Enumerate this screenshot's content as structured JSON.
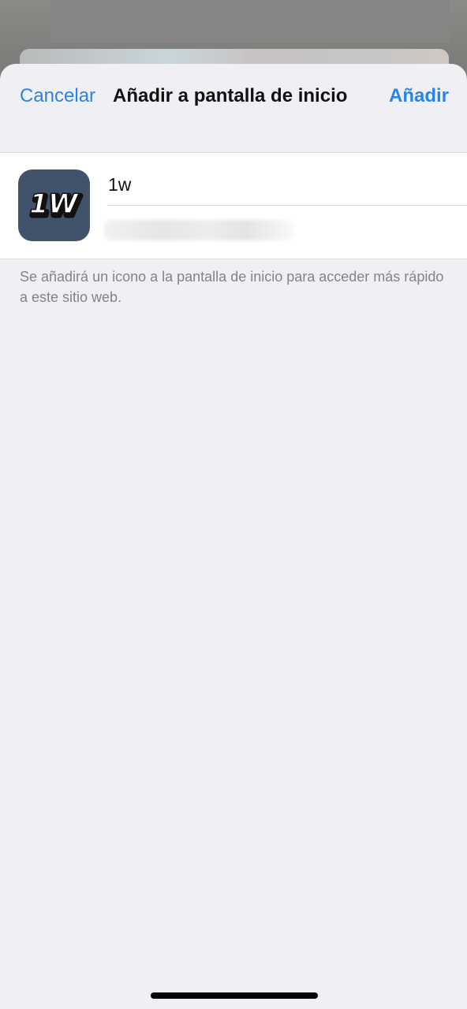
{
  "nav": {
    "cancel_label": "Cancelar",
    "title": "Añadir a pantalla de inicio",
    "add_label": "Añadir"
  },
  "shortcut": {
    "icon_text": "1W",
    "name_value": "1w"
  },
  "footnote": "Se añadirá un icono a la pantalla de inicio para acceder más rápido a este sitio web.",
  "colors": {
    "accent": "#2a84e6",
    "sheet_background": "#f0eff4",
    "icon_background": "#41526b"
  },
  "icons": {
    "app_icon": "app-icon-1w"
  }
}
